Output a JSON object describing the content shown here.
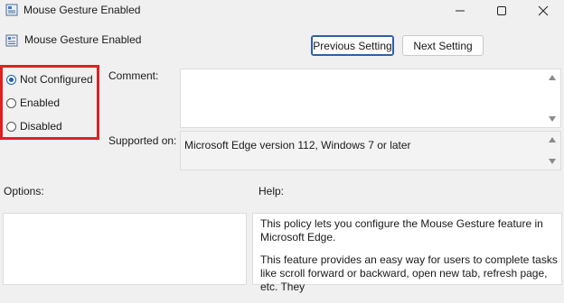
{
  "window": {
    "title": "Mouse Gesture Enabled",
    "minimize_glyph": "—",
    "maximize_glyph": "☐",
    "close_glyph": "✕"
  },
  "header": {
    "policy_name": "Mouse Gesture Enabled",
    "previous_label": "Previous Setting",
    "next_label": "Next Setting"
  },
  "state": {
    "options": [
      {
        "label": "Not Configured",
        "checked": true
      },
      {
        "label": "Enabled",
        "checked": false
      },
      {
        "label": "Disabled",
        "checked": false
      }
    ],
    "highlight_color": "#e02020"
  },
  "fields": {
    "comment_label": "Comment:",
    "supported_label": "Supported on:",
    "supported_value": "Microsoft Edge version 112, Windows 7 or later",
    "options_label": "Options:",
    "help_label": "Help:"
  },
  "help": {
    "paragraphs": [
      "This policy lets you configure the Mouse Gesture feature in Microsoft Edge.",
      "This feature provides an easy way for users to complete tasks like scroll forward or backward, open new tab, refresh page, etc. They"
    ]
  },
  "icons": {
    "app": "policy-app-icon",
    "policy": "policy-setting-icon"
  }
}
